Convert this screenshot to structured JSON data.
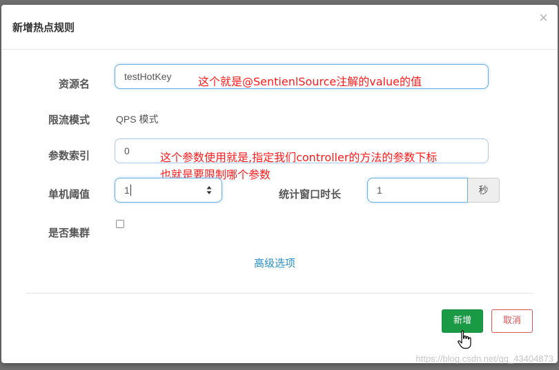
{
  "dialog": {
    "title": "新增热点规则",
    "close_glyph": "×"
  },
  "form": {
    "resource": {
      "label": "资源名",
      "value": "testHotKey"
    },
    "mode": {
      "label": "限流模式",
      "value": "QPS 模式"
    },
    "param_index": {
      "label": "参数索引",
      "value": "0"
    },
    "threshold": {
      "label": "单机阈值",
      "value": "1"
    },
    "window": {
      "label": "统计窗口时长",
      "value": "1",
      "unit": "秒"
    },
    "cluster": {
      "label": "是否集群",
      "checked": false
    },
    "advanced_link": "高级选项"
  },
  "annotations": {
    "resource_note": "这个就是@SentienlSource注解的value的值",
    "param_note_line1": "这个参数使用就是,指定我们controller的方法的参数下标",
    "param_note_line2": "也就是要限制哪个参数",
    "color": "#ff1a1a"
  },
  "footer": {
    "add_label": "新增",
    "cancel_label": "取消"
  },
  "watermark": "https://blog.csdn.net/qq_43404873",
  "colors": {
    "primary_green": "#1a9a45",
    "cancel_red": "#d9534f",
    "link_blue": "#2a8fc7",
    "focus_border": "#66afe9"
  }
}
